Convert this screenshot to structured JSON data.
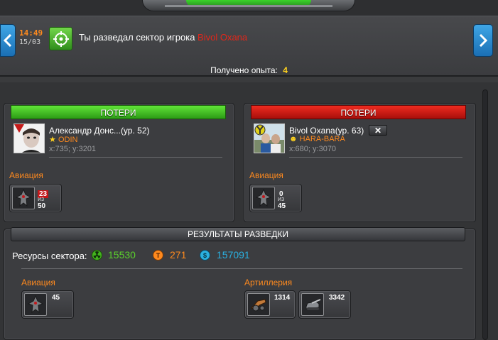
{
  "message": {
    "time": "14:49",
    "date": "15/03",
    "text_prefix": "Ты разведал сектор игрока ",
    "target_player": "Bivol Oxana"
  },
  "experience": {
    "label": "Получено опыта:",
    "value": "4"
  },
  "left_panel": {
    "header": "ПОТЕРИ",
    "player_name": "Александр Донс...(ур. 52)",
    "clan": "ODIN",
    "coords": "x:735; y:3201",
    "section_label": "Авиация",
    "unit": {
      "lost": "23",
      "of_label": "из",
      "total": "50"
    }
  },
  "right_panel": {
    "header": "ПОТЕРИ",
    "player_name": "Bivol Oxana(ур. 63)",
    "close_label": "✕",
    "clan": "HARA-BARA",
    "coords": "x:680; y:3070",
    "section_label": "Авиация",
    "unit": {
      "lost": "0",
      "of_label": "из",
      "total": "45"
    }
  },
  "results": {
    "header": "РЕЗУЛЬТАТЫ РАЗВЕДКИ",
    "resources_label": "Ресурсы сектора:",
    "resources": [
      {
        "icon": "radiation-icon",
        "value": "15530",
        "color": "#5bd12c"
      },
      {
        "icon": "titanium-icon",
        "value": "271",
        "color": "#ff8a1e"
      },
      {
        "icon": "credits-icon",
        "value": "157091",
        "color": "#2ab0e0"
      }
    ],
    "aviation_label": "Авиация",
    "aviation_units": [
      {
        "count": "45"
      }
    ],
    "artillery_label": "Артиллерия",
    "artillery_units": [
      {
        "count": "1314"
      },
      {
        "count": "3342"
      }
    ]
  },
  "colors": {
    "accent_orange": "#ff8a1e",
    "loss_green": "#3bb51e",
    "loss_red": "#d21a12",
    "nav_blue": "#2a8ad0"
  }
}
